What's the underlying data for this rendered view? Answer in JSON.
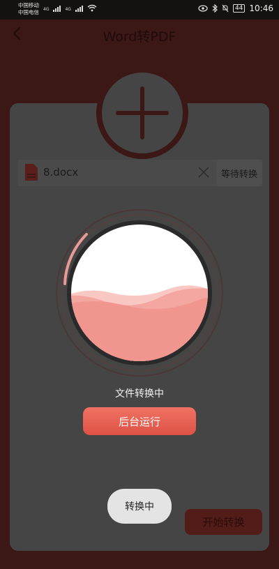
{
  "status_bar": {
    "carrier1": "中国移动",
    "carrier2": "中国电信",
    "net1": "4G",
    "net2": "4G",
    "battery": "44",
    "time": "10:46"
  },
  "header": {
    "title": "Word转PDF"
  },
  "file": {
    "name": "8.docx",
    "wait_label": "等待转换"
  },
  "progress": {
    "status_text": "文件转换中",
    "fill_fraction": 0.45
  },
  "buttons": {
    "background_run": "后台运行",
    "converting": "转换中",
    "start_convert": "开始转换"
  },
  "colors": {
    "overlay": "#3b1715",
    "card": "#454545",
    "accent": "#e85c4d",
    "wave_light": "#f7b3ad",
    "wave_dark": "#f08b86"
  }
}
